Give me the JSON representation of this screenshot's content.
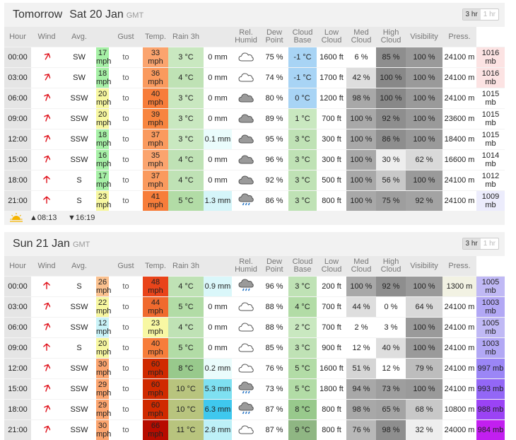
{
  "colors": {
    "header_bg": "#f2f2f2",
    "arrow": "#e0101a"
  },
  "headers": [
    "Hour",
    "Wind",
    "Avg.",
    "",
    "Gust",
    "Temp.",
    "Rain 3h",
    "",
    "Rel.\nHumid",
    "Dew\nPoint",
    "Cloud\nBase",
    "Low\nCloud",
    "Med\nCloud",
    "High\nCloud",
    "Visibility",
    "Press."
  ],
  "days": [
    {
      "title": "Tomorrow",
      "date": "Sat 20 Jan",
      "tz": "GMT",
      "toggle": [
        "3 hr",
        "1 hr"
      ],
      "sunrise": "▲08:13",
      "sunset": "▼16:19",
      "rows": [
        {
          "hour": "00:00",
          "rot": 30,
          "dir": "SW",
          "avg": "17 mph",
          "avgc": "#a6f0a6",
          "to": "to",
          "gust": "33 mph",
          "gustc": "#fba46e",
          "temp": "3 °C",
          "tempc": "#c9e8c0",
          "rain": "0 mm",
          "rainc": "#ffffff",
          "icon": "cloud",
          "hum": "75 %",
          "dew": "-1 °C",
          "dewc": "#a8d4f5",
          "base": "1600 ft",
          "low": "6 %",
          "lowc": "#ffffff",
          "med": "85 %",
          "medc": "#8e8e8e",
          "high": "100 %",
          "highc": "#9a9a9a",
          "vis": "24100 m",
          "visc": "#ffffff",
          "press": "1016 mb",
          "pressc": "#fce3e3"
        },
        {
          "hour": "03:00",
          "rot": 30,
          "dir": "SW",
          "avg": "18 mph",
          "avgc": "#a6f0a6",
          "to": "to",
          "gust": "36 mph",
          "gustc": "#fa9a5e",
          "temp": "4 °C",
          "tempc": "#bfe2b5",
          "rain": "0 mm",
          "rainc": "#ffffff",
          "icon": "cloud",
          "hum": "74 %",
          "dew": "-1 °C",
          "dewc": "#a8d4f5",
          "base": "1700 ft",
          "low": "42 %",
          "lowc": "#dedede",
          "med": "100 %",
          "medc": "#888888",
          "high": "100 %",
          "highc": "#9a9a9a",
          "vis": "24100 m",
          "visc": "#ffffff",
          "press": "1016 mb",
          "pressc": "#fce3e3"
        },
        {
          "hour": "06:00",
          "rot": 20,
          "dir": "SSW",
          "avg": "20 mph",
          "avgc": "#f7f7a0",
          "to": "to",
          "gust": "40 mph",
          "gustc": "#f77d3a",
          "temp": "3 °C",
          "tempc": "#c9e8c0",
          "rain": "0 mm",
          "rainc": "#ffffff",
          "icon": "cloud-dark",
          "hum": "80 %",
          "dew": "0 °C",
          "dewc": "#a8d4f5",
          "base": "1200 ft",
          "low": "98 %",
          "lowc": "#a8a8a8",
          "med": "100 %",
          "medc": "#888888",
          "high": "100 %",
          "highc": "#9a9a9a",
          "vis": "24100 m",
          "visc": "#ffffff",
          "press": "1015 mb",
          "pressc": "#ffffff"
        },
        {
          "hour": "09:00",
          "rot": 20,
          "dir": "SSW",
          "avg": "20 mph",
          "avgc": "#f7f7a0",
          "to": "to",
          "gust": "39 mph",
          "gustc": "#f8853f",
          "temp": "3 °C",
          "tempc": "#c9e8c0",
          "rain": "0 mm",
          "rainc": "#ffffff",
          "icon": "cloud-dark",
          "hum": "89 %",
          "dew": "1 °C",
          "dewc": "#c9e8c0",
          "base": "700 ft",
          "low": "100 %",
          "lowc": "#a8a8a8",
          "med": "92 %",
          "medc": "#8e8e8e",
          "high": "100 %",
          "highc": "#9a9a9a",
          "vis": "23600 m",
          "visc": "#ffffff",
          "press": "1015 mb",
          "pressc": "#ffffff"
        },
        {
          "hour": "12:00",
          "rot": 20,
          "dir": "SSW",
          "avg": "18 mph",
          "avgc": "#a6f0a6",
          "to": "to",
          "gust": "37 mph",
          "gustc": "#fa9a5e",
          "temp": "3 °C",
          "tempc": "#c9e8c0",
          "rain": "0.1 mm",
          "rainc": "#eafcfc",
          "icon": "cloud-dark",
          "hum": "95 %",
          "dew": "3 °C",
          "dewc": "#bfe2b5",
          "base": "300 ft",
          "low": "100 %",
          "lowc": "#a8a8a8",
          "med": "86 %",
          "medc": "#8e8e8e",
          "high": "100 %",
          "highc": "#9a9a9a",
          "vis": "18400 m",
          "visc": "#ffffff",
          "press": "1015 mb",
          "pressc": "#ffffff"
        },
        {
          "hour": "15:00",
          "rot": 20,
          "dir": "SSW",
          "avg": "16 mph",
          "avgc": "#a6f0a6",
          "to": "to",
          "gust": "35 mph",
          "gustc": "#fba46e",
          "temp": "4 °C",
          "tempc": "#bfe2b5",
          "rain": "0 mm",
          "rainc": "#ffffff",
          "icon": "cloud-dark",
          "hum": "96 %",
          "dew": "3 °C",
          "dewc": "#bfe2b5",
          "base": "300 ft",
          "low": "100 %",
          "lowc": "#a8a8a8",
          "med": "30 %",
          "medc": "#eeeeee",
          "high": "62 %",
          "highc": "#d9d9d9",
          "vis": "16600 m",
          "visc": "#ffffff",
          "press": "1014 mb",
          "pressc": "#ffffff"
        },
        {
          "hour": "18:00",
          "rot": 0,
          "dir": "S",
          "avg": "17 mph",
          "avgc": "#a6f0a6",
          "to": "to",
          "gust": "37 mph",
          "gustc": "#fa9a5e",
          "temp": "4 °C",
          "tempc": "#bfe2b5",
          "rain": "0 mm",
          "rainc": "#ffffff",
          "icon": "cloud-dark",
          "hum": "92 %",
          "dew": "3 °C",
          "dewc": "#bfe2b5",
          "base": "500 ft",
          "low": "100 %",
          "lowc": "#a8a8a8",
          "med": "56 %",
          "medc": "#c8c8c8",
          "high": "100 %",
          "highc": "#9a9a9a",
          "vis": "24100 m",
          "visc": "#ffffff",
          "press": "1012 mb",
          "pressc": "#ffffff"
        },
        {
          "hour": "21:00",
          "rot": 0,
          "dir": "S",
          "avg": "23 mph",
          "avgc": "#f7f7a0",
          "to": "to",
          "gust": "41 mph",
          "gustc": "#f77d3a",
          "temp": "5 °C",
          "tempc": "#b2dca6",
          "rain": "1.3 mm",
          "rainc": "#d5f5f9",
          "icon": "cloud-rain",
          "hum": "86 %",
          "dew": "3 °C",
          "dewc": "#bfe2b5",
          "base": "800 ft",
          "low": "100 %",
          "lowc": "#a8a8a8",
          "med": "75 %",
          "medc": "#9e9e9e",
          "high": "92 %",
          "highc": "#a3a3a3",
          "vis": "24100 m",
          "visc": "#ffffff",
          "press": "1009 mb",
          "pressc": "#ececfc"
        }
      ]
    },
    {
      "title": "",
      "date": "Sun 21 Jan",
      "tz": "GMT",
      "toggle": [
        "3 hr",
        "1 hr"
      ],
      "sunrise": "",
      "sunset": "",
      "rows": [
        {
          "hour": "00:00",
          "rot": 0,
          "dir": "S",
          "avg": "26 mph",
          "avgc": "#fbc18f",
          "to": "to",
          "gust": "48 mph",
          "gustc": "#e9441a",
          "temp": "4 °C",
          "tempc": "#bfe2b5",
          "rain": "0.9 mm",
          "rainc": "#daf7fa",
          "icon": "cloud-rain",
          "hum": "96 %",
          "dew": "3 °C",
          "dewc": "#bfe2b5",
          "base": "200 ft",
          "low": "100 %",
          "lowc": "#a8a8a8",
          "med": "92 %",
          "medc": "#8e8e8e",
          "high": "100 %",
          "highc": "#9a9a9a",
          "vis": "1300 m",
          "visc": "#f2f2e3",
          "press": "1005 mb",
          "pressc": "#c0b9f5"
        },
        {
          "hour": "03:00",
          "rot": 20,
          "dir": "SSW",
          "avg": "22 mph",
          "avgc": "#f7f7a0",
          "to": "to",
          "gust": "44 mph",
          "gustc": "#f06a2e",
          "temp": "5 °C",
          "tempc": "#b2dca6",
          "rain": "0 mm",
          "rainc": "#ffffff",
          "icon": "cloud",
          "hum": "88 %",
          "dew": "4 °C",
          "dewc": "#b2dca6",
          "base": "700 ft",
          "low": "44 %",
          "lowc": "#dedede",
          "med": "0 %",
          "medc": "#ffffff",
          "high": "64 %",
          "highc": "#d9d9d9",
          "vis": "24100 m",
          "visc": "#ffffff",
          "press": "1003 mb",
          "pressc": "#b2a8f5"
        },
        {
          "hour": "06:00",
          "rot": 20,
          "dir": "SSW",
          "avg": "12 mph",
          "avgc": "#c9f3f8",
          "to": "to",
          "gust": "23 mph",
          "gustc": "#f8f8a3",
          "temp": "4 °C",
          "tempc": "#bfe2b5",
          "rain": "0 mm",
          "rainc": "#ffffff",
          "icon": "cloud",
          "hum": "88 %",
          "dew": "2 °C",
          "dewc": "#c9e8c0",
          "base": "700 ft",
          "low": "2 %",
          "lowc": "#ffffff",
          "med": "3 %",
          "medc": "#ffffff",
          "high": "100 %",
          "highc": "#9a9a9a",
          "vis": "24100 m",
          "visc": "#ffffff",
          "press": "1005 mb",
          "pressc": "#c0b9f5"
        },
        {
          "hour": "09:00",
          "rot": 0,
          "dir": "S",
          "avg": "20 mph",
          "avgc": "#f7f7a0",
          "to": "to",
          "gust": "40 mph",
          "gustc": "#f77d3a",
          "temp": "5 °C",
          "tempc": "#b2dca6",
          "rain": "0 mm",
          "rainc": "#ffffff",
          "icon": "cloud",
          "hum": "85 %",
          "dew": "3 °C",
          "dewc": "#bfe2b5",
          "base": "900 ft",
          "low": "12 %",
          "lowc": "#ffffff",
          "med": "40 %",
          "medc": "#dedede",
          "high": "100 %",
          "highc": "#9a9a9a",
          "vis": "24100 m",
          "visc": "#ffffff",
          "press": "1003 mb",
          "pressc": "#b2a8f5"
        },
        {
          "hour": "12:00",
          "rot": 20,
          "dir": "SSW",
          "avg": "30 mph",
          "avgc": "#fba46e",
          "to": "to",
          "gust": "60 mph",
          "gustc": "#d02a00",
          "temp": "8 °C",
          "tempc": "#98c98c",
          "rain": "0.2 mm",
          "rainc": "#eafcfc",
          "icon": "cloud",
          "hum": "76 %",
          "dew": "5 °C",
          "dewc": "#b2dca6",
          "base": "1600 ft",
          "low": "51 %",
          "lowc": "#d5d5d5",
          "med": "12 %",
          "medc": "#ffffff",
          "high": "79 %",
          "highc": "#bdbdbd",
          "vis": "24100 m",
          "visc": "#ffffff",
          "press": "997 mb",
          "pressc": "#9b86f6"
        },
        {
          "hour": "15:00",
          "rot": 20,
          "dir": "SSW",
          "avg": "29 mph",
          "avgc": "#fba46e",
          "to": "to",
          "gust": "60 mph",
          "gustc": "#d02a00",
          "temp": "10 °C",
          "tempc": "#b8c47e",
          "rain": "5.3 mm",
          "rainc": "#7ee0f1",
          "icon": "cloud-rain",
          "hum": "73 %",
          "dew": "5 °C",
          "dewc": "#b2dca6",
          "base": "1800 ft",
          "low": "94 %",
          "lowc": "#a8a8a8",
          "med": "73 %",
          "medc": "#9e9e9e",
          "high": "100 %",
          "highc": "#9a9a9a",
          "vis": "24100 m",
          "visc": "#ffffff",
          "press": "993 mb",
          "pressc": "#9367f6"
        },
        {
          "hour": "18:00",
          "rot": 20,
          "dir": "SSW",
          "avg": "29 mph",
          "avgc": "#fba46e",
          "to": "to",
          "gust": "60 mph",
          "gustc": "#d02a00",
          "temp": "10 °C",
          "tempc": "#b8c47e",
          "rain": "6.3 mm",
          "rainc": "#3fc8ee",
          "icon": "cloud-rain",
          "hum": "87 %",
          "dew": "8 °C",
          "dewc": "#98c98c",
          "base": "800 ft",
          "low": "98 %",
          "lowc": "#a8a8a8",
          "med": "65 %",
          "medc": "#a4a4a4",
          "high": "68 %",
          "highc": "#c8c8c8",
          "vis": "10800 m",
          "visc": "#ffffff",
          "press": "988 mb",
          "pressc": "#9b43f5"
        },
        {
          "hour": "21:00",
          "rot": 20,
          "dir": "SSW",
          "avg": "30 mph",
          "avgc": "#fba46e",
          "to": "to",
          "gust": "66 mph",
          "gustc": "#b70c00",
          "temp": "11 °C",
          "tempc": "#b8c47e",
          "rain": "2.8 mm",
          "rainc": "#bdf0f7",
          "icon": "cloud",
          "hum": "87 %",
          "dew": "9 °C",
          "dewc": "#8fb683",
          "base": "800 ft",
          "low": "76 %",
          "lowc": "#b8b8b8",
          "med": "98 %",
          "medc": "#8e8e8e",
          "high": "32 %",
          "highc": "#eeeeee",
          "vis": "24000 m",
          "visc": "#ffffff",
          "press": "984 mb",
          "pressc": "#c21ff0"
        }
      ]
    }
  ]
}
